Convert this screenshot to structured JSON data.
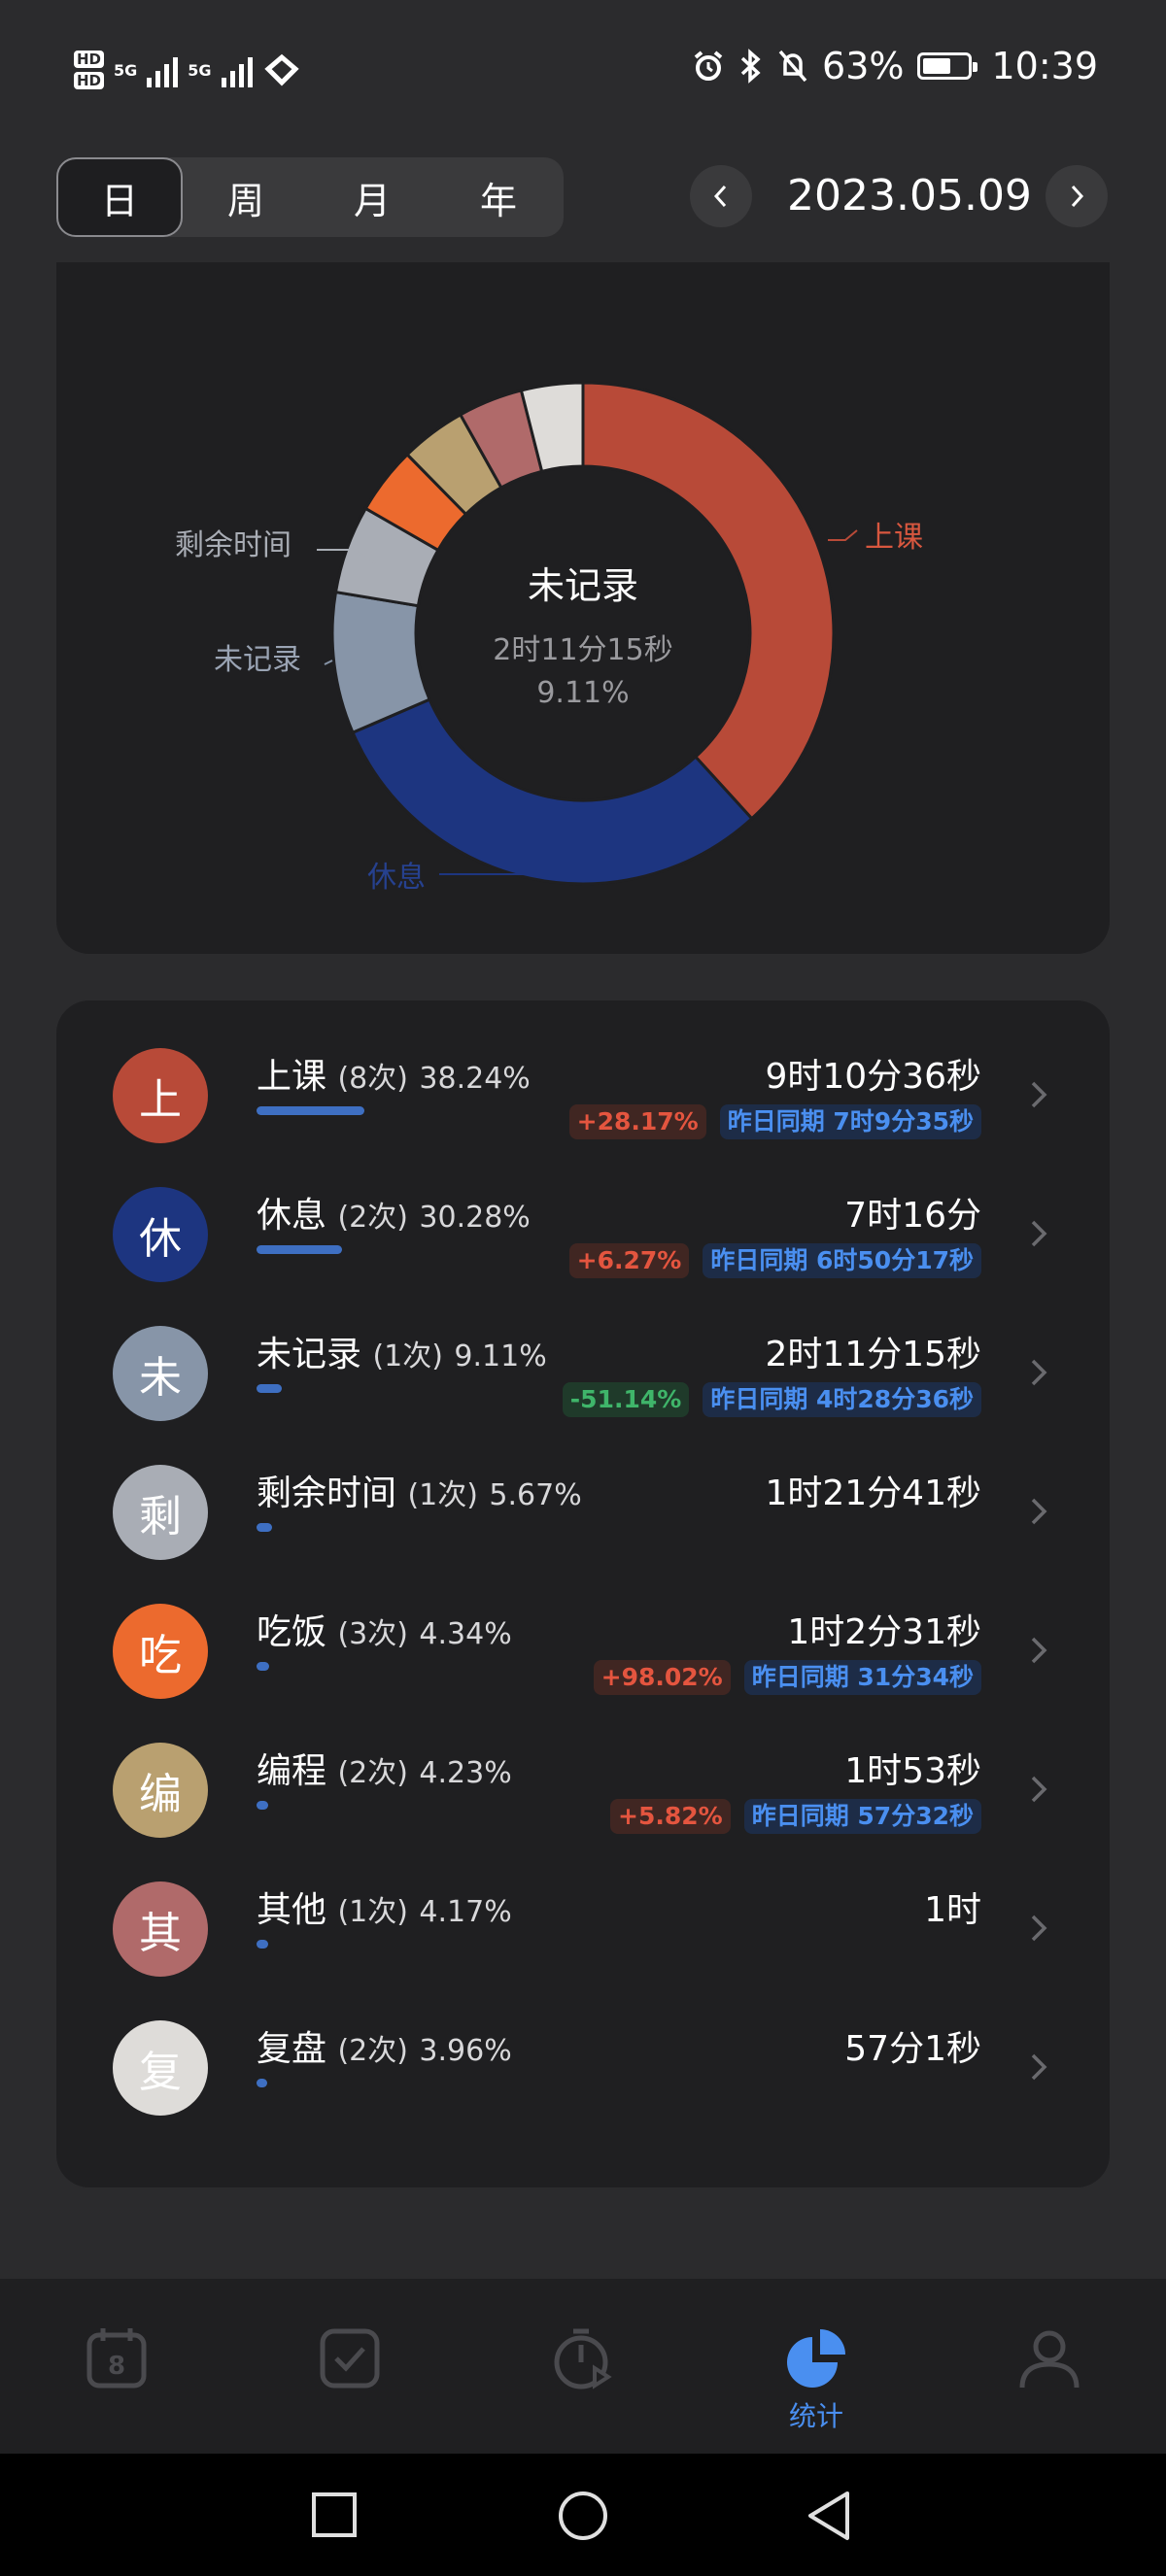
{
  "status_bar": {
    "hd1": "HD",
    "hd2": "HD",
    "net1": "5G",
    "net2": "5G",
    "battery": "63%",
    "battery_level": 0.63,
    "time": "10:39"
  },
  "period_tabs": [
    {
      "label": "日",
      "active": true
    },
    {
      "label": "周",
      "active": false
    },
    {
      "label": "月",
      "active": false
    },
    {
      "label": "年",
      "active": false
    }
  ],
  "date": "2023.05.09",
  "chart_data": {
    "type": "pie",
    "style": "donut",
    "center": {
      "title": "未记录",
      "duration": "2时11分15秒",
      "percent": "9.11%"
    },
    "slices": [
      {
        "label": "上课",
        "value": 38.24,
        "color": "#b84a38",
        "labeled": true
      },
      {
        "label": "休息",
        "value": 30.28,
        "color": "#1d3580",
        "labeled": true
      },
      {
        "label": "未记录",
        "value": 9.11,
        "color": "#8795a8",
        "labeled": true
      },
      {
        "label": "剩余时间",
        "value": 5.67,
        "color": "#a9adb5",
        "labeled": true
      },
      {
        "label": "吃饭",
        "value": 4.34,
        "color": "#ec6a2e",
        "labeled": false
      },
      {
        "label": "编程",
        "value": 4.23,
        "color": "#b9a070",
        "labeled": false
      },
      {
        "label": "其他",
        "value": 4.17,
        "color": "#b06a6a",
        "labeled": false
      },
      {
        "label": "复盘",
        "value": 3.96,
        "color": "#dedcd9",
        "labeled": false
      }
    ]
  },
  "activities": [
    {
      "initial": "上",
      "color": "#b84a38",
      "name": "上课",
      "count": "(8次)",
      "percent": "38.24%",
      "share": 0.3824,
      "duration": "9时10分36秒",
      "change": "+28.17%",
      "change_dir": "up",
      "prev": "昨日同期 7时9分35秒"
    },
    {
      "initial": "休",
      "color": "#1d3580",
      "name": "休息",
      "count": "(2次)",
      "percent": "30.28%",
      "share": 0.3028,
      "duration": "7时16分",
      "change": "+6.27%",
      "change_dir": "up",
      "prev": "昨日同期 6时50分17秒"
    },
    {
      "initial": "未",
      "color": "#8795a8",
      "name": "未记录",
      "count": "(1次)",
      "percent": "9.11%",
      "share": 0.0911,
      "duration": "2时11分15秒",
      "change": "-51.14%",
      "change_dir": "down",
      "prev": "昨日同期 4时28分36秒"
    },
    {
      "initial": "剩",
      "color": "#a9adb5",
      "name": "剩余时间",
      "count": "(1次)",
      "percent": "5.67%",
      "share": 0.0567,
      "duration": "1时21分41秒",
      "change": "",
      "change_dir": "",
      "prev": ""
    },
    {
      "initial": "吃",
      "color": "#ec6a2e",
      "name": "吃饭",
      "count": "(3次)",
      "percent": "4.34%",
      "share": 0.0434,
      "duration": "1时2分31秒",
      "change": "+98.02%",
      "change_dir": "up",
      "prev": "昨日同期 31分34秒"
    },
    {
      "initial": "编",
      "color": "#b9a070",
      "name": "编程",
      "count": "(2次)",
      "percent": "4.23%",
      "share": 0.0423,
      "duration": "1时53秒",
      "change": "+5.82%",
      "change_dir": "up",
      "prev": "昨日同期 57分32秒"
    },
    {
      "initial": "其",
      "color": "#b06a6a",
      "name": "其他",
      "count": "(1次)",
      "percent": "4.17%",
      "share": 0.0417,
      "duration": "1时",
      "change": "",
      "change_dir": "",
      "prev": ""
    },
    {
      "initial": "复",
      "color": "#dedcd9",
      "name": "复盘",
      "count": "(2次)",
      "percent": "3.96%",
      "share": 0.0396,
      "duration": "57分1秒",
      "change": "",
      "change_dir": "",
      "prev": ""
    }
  ],
  "bottom_nav": [
    {
      "icon": "calendar-icon",
      "label": "",
      "active": false,
      "calendar_day": "8"
    },
    {
      "icon": "checkbox-icon",
      "label": "",
      "active": false
    },
    {
      "icon": "timer-icon",
      "label": "",
      "active": false
    },
    {
      "icon": "pie-chart-icon",
      "label": "统计",
      "active": true
    },
    {
      "icon": "profile-icon",
      "label": "",
      "active": false
    }
  ],
  "colors": {
    "accent": "#4a8ff0",
    "background": "#2b2b2d",
    "card": "#1f1f21"
  }
}
